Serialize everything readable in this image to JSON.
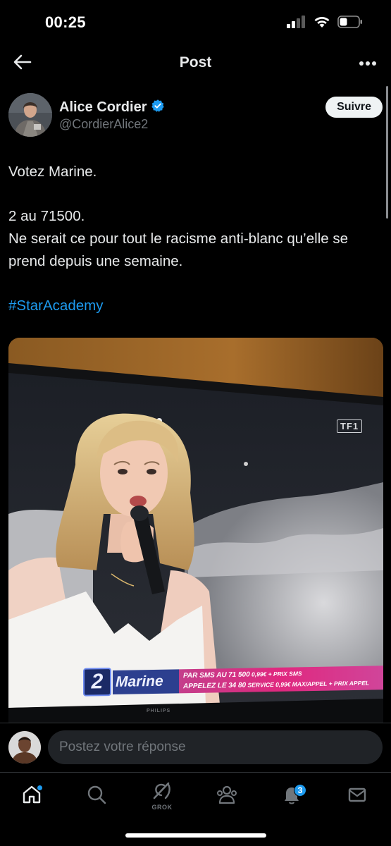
{
  "status_bar": {
    "time": "00:25",
    "icons": [
      "signal-icon",
      "wifi-icon",
      "battery-icon"
    ]
  },
  "header": {
    "title": "Post",
    "back_icon": "arrow-left-icon",
    "more_icon": "more-dots-icon"
  },
  "author": {
    "name": "Alice Cordier",
    "handle": "@CordierAlice2",
    "verified": true,
    "follow_label": "Suivre"
  },
  "tweet": {
    "line1": "Votez Marine.",
    "line2": "2 au 71500.\nNe serait ce pour tout le racisme anti-blanc qu’elle se prend depuis une semaine.",
    "hashtag": "#StarAcademy"
  },
  "media": {
    "channel_logo": "TF1",
    "candidate_number": "2",
    "candidate_name": "Marine",
    "vote_line1_prefix": "PAR SMS AU",
    "vote_line1_number": "71 500",
    "vote_line1_suffix": "0,99€ + PRIX SMS",
    "vote_line2_prefix": "APPELEZ LE",
    "vote_line2_number": "34 80",
    "vote_line2_suffix": "SERVICE 0,99€ MAX/APPEL + PRIX APPEL",
    "tv_brand": "PHILIPS"
  },
  "reply": {
    "placeholder": "Postez votre réponse"
  },
  "nav": {
    "items": [
      "home-icon",
      "search-icon",
      "grok-icon",
      "communities-icon",
      "notifications-icon",
      "messages-icon"
    ],
    "grok_label": "GROK",
    "notification_count": "3"
  },
  "colors": {
    "accent": "#1d9bf0",
    "background": "#000000",
    "text": "#e7e9ea",
    "muted": "#71767b",
    "banner_pink": "#e0287f"
  }
}
